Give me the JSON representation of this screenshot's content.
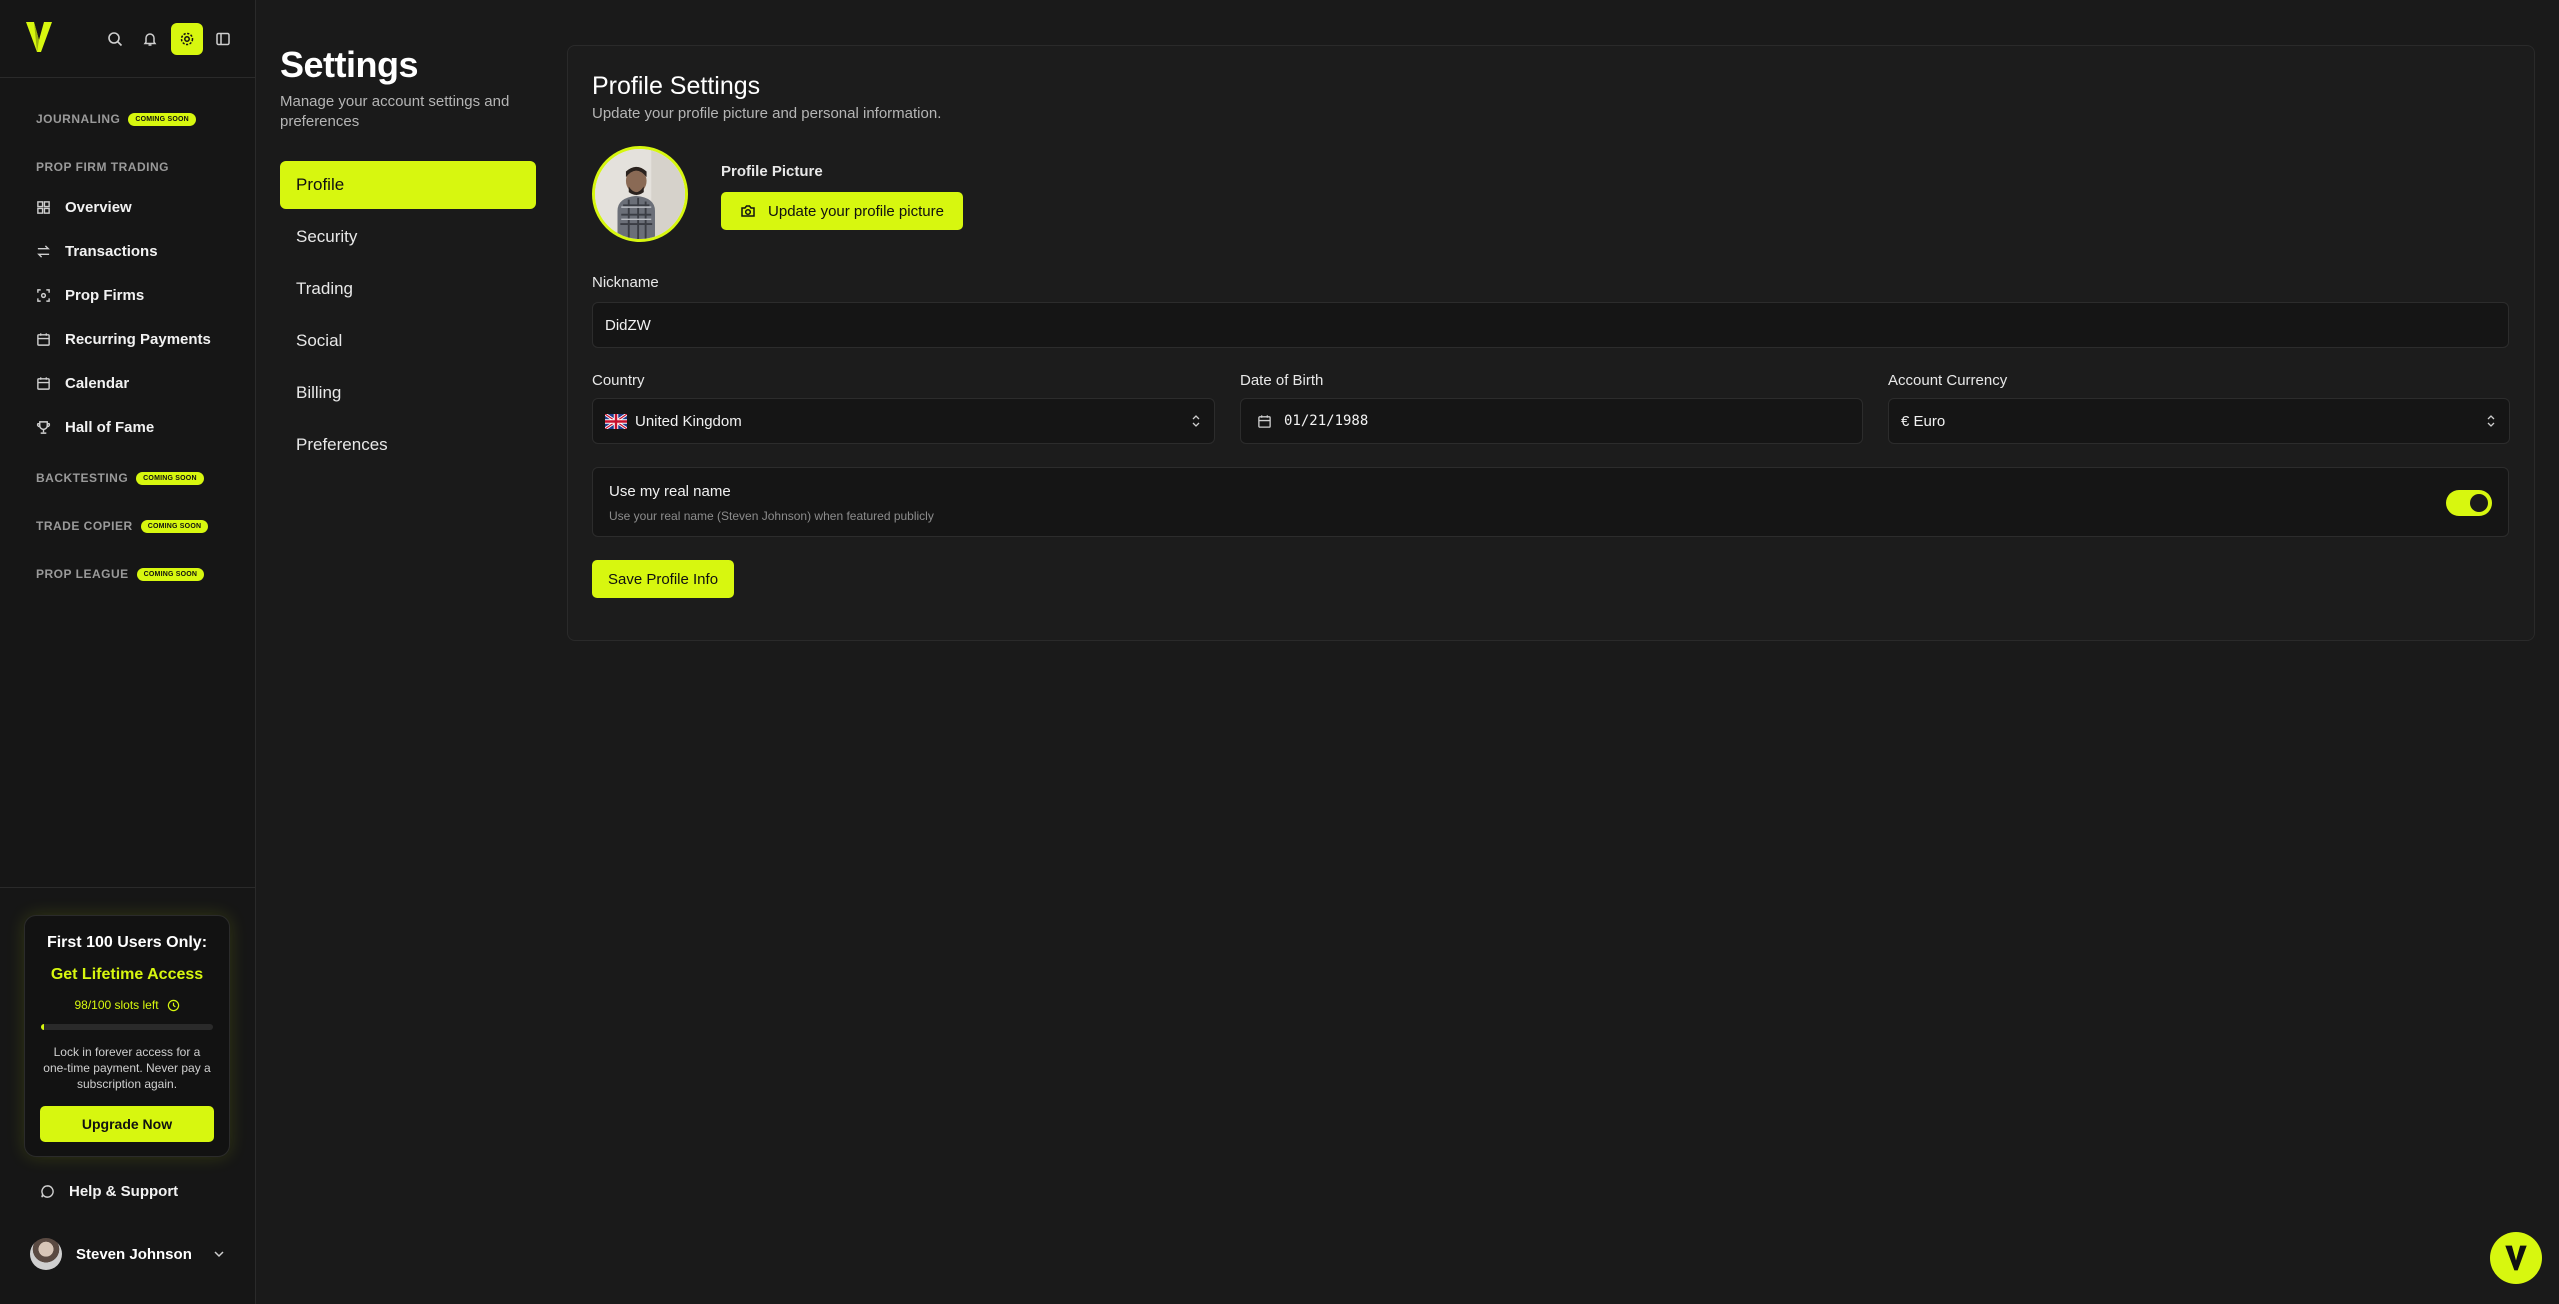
{
  "sidebar": {
    "sections": {
      "journaling": "JOURNALING",
      "prop_firm_trading": "PROP FIRM TRADING",
      "backtesting": "BACKTESTING",
      "trade_copier": "TRADE COPIER",
      "prop_league": "PROP LEAGUE"
    },
    "coming_soon": "COMING SOON",
    "items": {
      "overview": "Overview",
      "transactions": "Transactions",
      "prop_firms": "Prop Firms",
      "recurring_payments": "Recurring Payments",
      "calendar": "Calendar",
      "hall_of_fame": "Hall of Fame"
    },
    "promo": {
      "title": "First 100 Users Only:",
      "subtitle": "Get Lifetime Access",
      "slots": "98/100 slots left",
      "progress_fraction": 0.02,
      "description": "Lock in forever access for a one-time payment. Never pay a subscription again.",
      "button": "Upgrade Now"
    },
    "help": "Help & Support",
    "user_name": "Steven Johnson"
  },
  "settings": {
    "title": "Settings",
    "description": "Manage your account settings and preferences",
    "menu": [
      "Profile",
      "Security",
      "Trading",
      "Social",
      "Billing",
      "Preferences"
    ],
    "active": "Profile"
  },
  "profile": {
    "title": "Profile Settings",
    "subtitle": "Update your profile picture and personal information.",
    "picture_label": "Profile Picture",
    "picture_button": "Update your profile picture",
    "nickname_label": "Nickname",
    "nickname_value": "DidZW",
    "country_label": "Country",
    "country_value": "United Kingdom",
    "dob_label": "Date of Birth",
    "dob_value": "01/21/1988",
    "currency_label": "Account Currency",
    "currency_value": "€ Euro",
    "real_name_title": "Use my real name",
    "real_name_desc": "Use your real name (Steven Johnson) when featured publicly",
    "real_name_enabled": true,
    "save_button": "Save Profile Info"
  },
  "colors": {
    "accent": "#d7f70f",
    "background": "#1a1a1a",
    "sidebar": "#161616"
  }
}
